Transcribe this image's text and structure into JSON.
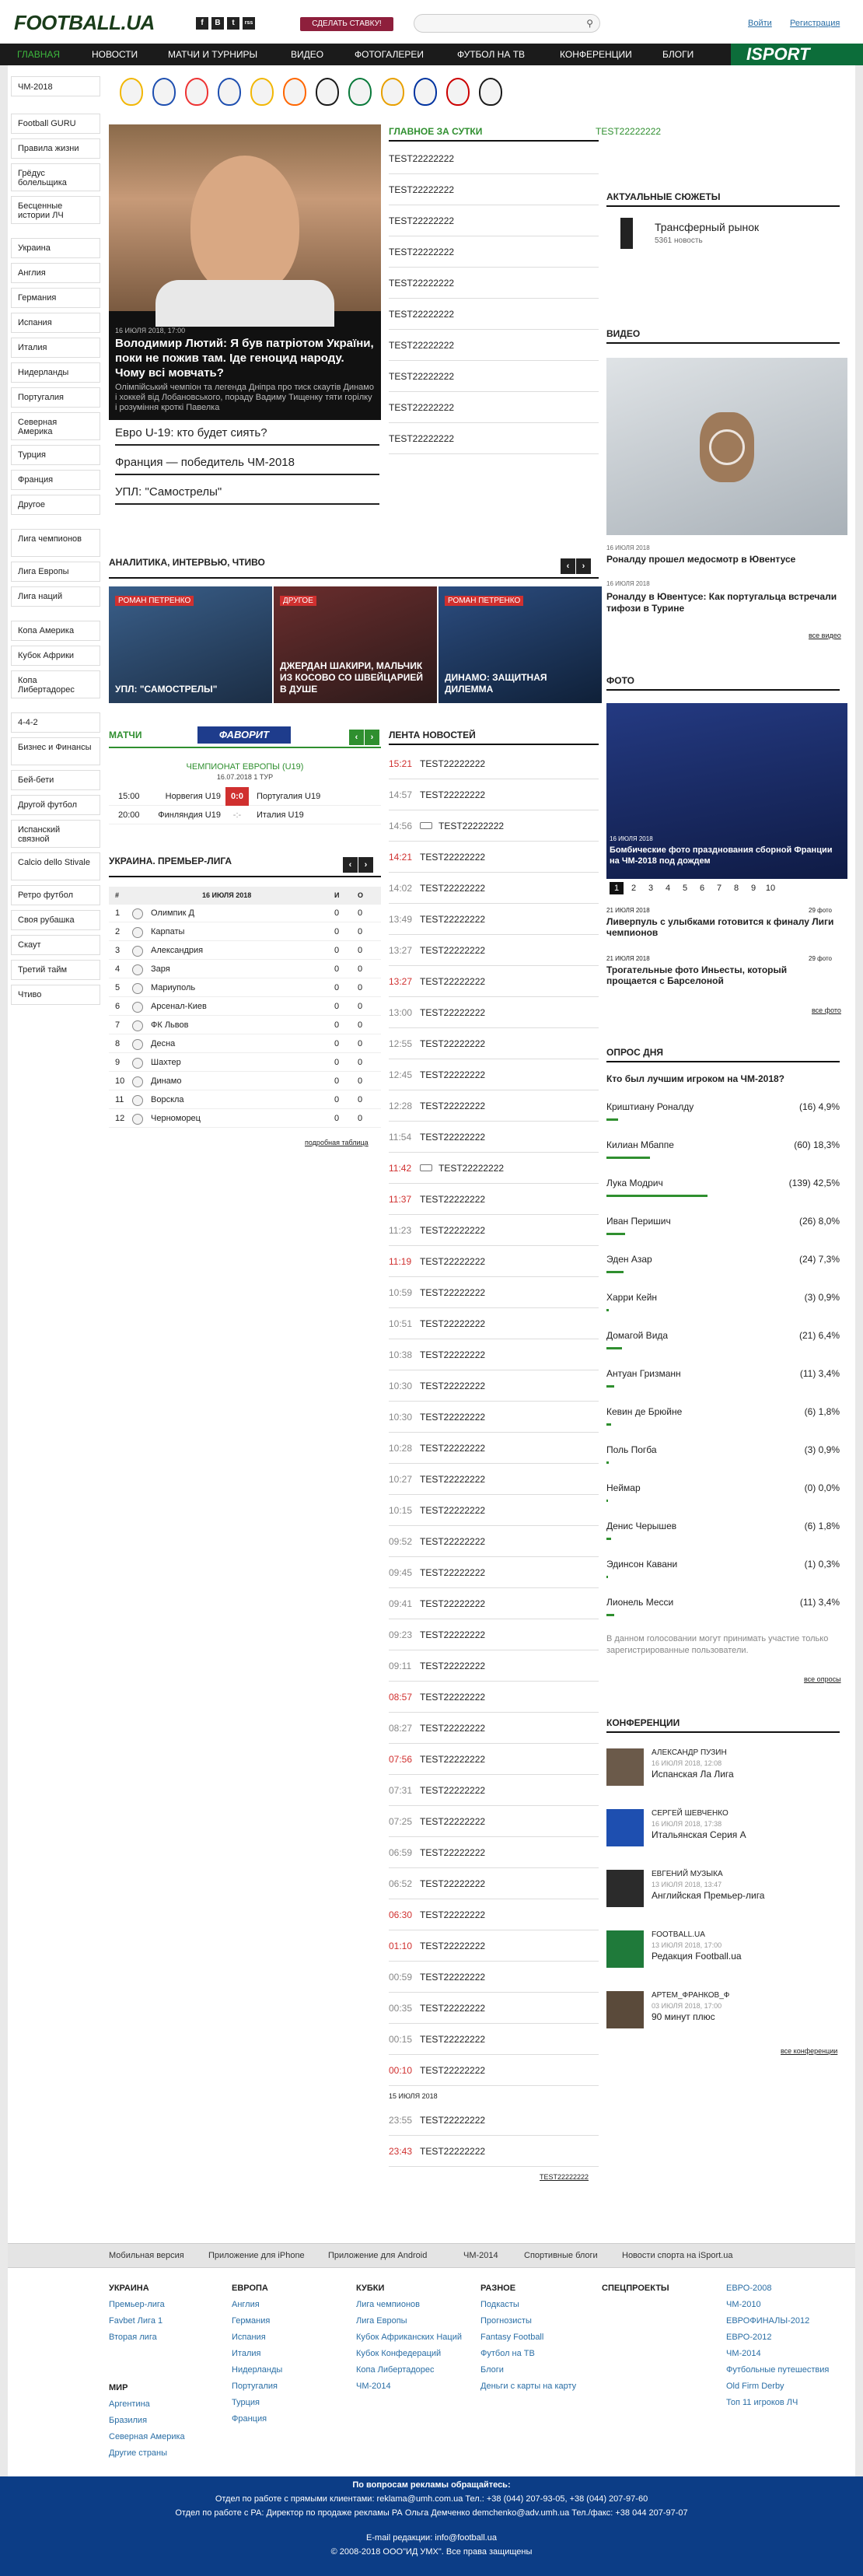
{
  "header": {
    "logo": "FOOTBALL.UA",
    "social": [
      "f",
      "В",
      "t",
      "rss"
    ],
    "start_button": "СДЕЛАТЬ СТАВКУ!",
    "login": "Войти",
    "register": "Регистрация",
    "isport": "ISPORT"
  },
  "nav": {
    "items": [
      "ГЛАВНАЯ",
      "НОВОСТИ",
      "МАТЧИ И ТУРНИРЫ",
      "ВИДЕО",
      "ФОТОГАЛЕРЕИ",
      "ФУТБОЛ НА ТВ",
      "КОНФЕРЕНЦИИ",
      "БЛОГИ"
    ]
  },
  "sidebar": {
    "top": "ЧМ-2018",
    "groups": [
      [
        "Football GURU",
        "Правила жизни",
        "Грёдус болельщика",
        "Бесценные истории ЛЧ"
      ],
      [
        "Украина",
        "Англия",
        "Германия",
        "Испания",
        "Италия",
        "Нидерланды",
        "Португалия",
        "Северная Америка",
        "Турция",
        "Франция",
        "Другое"
      ],
      [
        "Лига чемпионов",
        "Лига Европы",
        "Лига наций"
      ],
      [
        "Копа Америка",
        "Кубок Африки",
        "Копа Либертадорес"
      ],
      [
        "4-4-2",
        "Бизнес и Финансы",
        "Бей-бети",
        "Другой футбол",
        "Испанский связной",
        "Calcio dello Stivale",
        "Ретро футбол",
        "Своя рубашка",
        "Скаут",
        "Третий тайм",
        "Чтиво"
      ]
    ]
  },
  "hero": {
    "date": "16 ИЮЛЯ 2018, 17:00",
    "title": "Володимир Лютий: Я був патріотом України, поки не пожив там. Іде геноцид народу. Чому всі мовчать?",
    "sub": "Олімпійський чемпіон та легенда Дніпра про тиск скаутів Динамо і хоккей від Лобановського, пораду Вадиму Тищенку тяти горілку і розуміння кроткі Павелка"
  },
  "top_links": [
    "Евро U-19: кто будет сиять?",
    "Франция — победитель ЧМ-2018",
    "УПЛ: \"Самострелы\""
  ],
  "main_day": {
    "title": "ГЛАВНОЕ ЗА СУТКИ",
    "side_label": "TEST22222222",
    "items": [
      "TEST22222222",
      "TEST22222222",
      "TEST22222222",
      "TEST22222222",
      "TEST22222222",
      "TEST22222222",
      "TEST22222222",
      "TEST22222222",
      "TEST22222222",
      "TEST22222222"
    ]
  },
  "analytics": {
    "title": "АНАЛИТИКА, ИНТЕРВЬЮ, ЧТИВО",
    "cards": [
      {
        "tag": "РОМАН ПЕТРЕНКО",
        "title": "УПЛ: \"САМОСТРЕЛЫ\""
      },
      {
        "tag": "ДРУГОЕ",
        "title": "ДЖЕРДАН ШАКИРИ, МАЛЬЧИК ИЗ КОСОВО СО ШВЕЙЦАРИЕЙ В ДУШЕ"
      },
      {
        "tag": "РОМАН ПЕТРЕНКО",
        "title": "ДИНАМО: ЗАЩИТНАЯ ДИЛЕММА"
      }
    ]
  },
  "matches": {
    "title": "МАТЧИ",
    "sponsor": "ФАВОРИТ",
    "league": "ЧЕМПИОНАТ ЕВРОПЫ (U19)",
    "round": "16.07.2018 1 ТУР",
    "games": [
      {
        "time": "15:00",
        "home": "Норвегия U19",
        "score": "0:0",
        "away": "Португалия U19"
      },
      {
        "time": "20:00",
        "home": "Финляндия U19",
        "score": "-:-",
        "away": "Италия U19"
      }
    ]
  },
  "league_table": {
    "title": "УКРАИНА. ПРЕМЬЕР-ЛИГА",
    "col_num": "#",
    "col_date": "16 ИЮЛЯ 2018",
    "col_games": "И",
    "col_points": "О",
    "rows": [
      [
        "1",
        "Олимпик Д",
        "0",
        "0"
      ],
      [
        "2",
        "Карпаты",
        "0",
        "0"
      ],
      [
        "3",
        "Александрия",
        "0",
        "0"
      ],
      [
        "4",
        "Заря",
        "0",
        "0"
      ],
      [
        "5",
        "Мариуполь",
        "0",
        "0"
      ],
      [
        "6",
        "Арсенал-Киев",
        "0",
        "0"
      ],
      [
        "7",
        "ФК Львов",
        "0",
        "0"
      ],
      [
        "8",
        "Десна",
        "0",
        "0"
      ],
      [
        "9",
        "Шахтер",
        "0",
        "0"
      ],
      [
        "10",
        "Динамо",
        "0",
        "0"
      ],
      [
        "11",
        "Ворскла",
        "0",
        "0"
      ],
      [
        "12",
        "Черноморец",
        "0",
        "0"
      ]
    ],
    "more": "подробная таблица"
  },
  "news_feed": {
    "title": "ЛЕНТА НОВОСТЕЙ",
    "items": [
      [
        "15:21",
        "TEST22222222",
        "red"
      ],
      [
        "14:57",
        "TEST22222222",
        ""
      ],
      [
        "14:56",
        "TEST22222222",
        "cam"
      ],
      [
        "14:21",
        "TEST22222222",
        "red"
      ],
      [
        "14:02",
        "TEST22222222",
        ""
      ],
      [
        "13:49",
        "TEST22222222",
        ""
      ],
      [
        "13:27",
        "TEST22222222",
        ""
      ],
      [
        "13:27",
        "TEST22222222",
        "red"
      ],
      [
        "13:00",
        "TEST22222222",
        ""
      ],
      [
        "12:55",
        "TEST22222222",
        ""
      ],
      [
        "12:45",
        "TEST22222222",
        ""
      ],
      [
        "12:28",
        "TEST22222222",
        ""
      ],
      [
        "11:54",
        "TEST22222222",
        ""
      ],
      [
        "11:42",
        "TEST22222222",
        "redcam"
      ],
      [
        "11:37",
        "TEST22222222",
        "red"
      ],
      [
        "11:23",
        "TEST22222222",
        ""
      ],
      [
        "11:19",
        "TEST22222222",
        "red"
      ],
      [
        "10:59",
        "TEST22222222",
        ""
      ],
      [
        "10:51",
        "TEST22222222",
        ""
      ],
      [
        "10:38",
        "TEST22222222",
        ""
      ],
      [
        "10:30",
        "TEST22222222",
        ""
      ],
      [
        "10:30",
        "TEST22222222",
        ""
      ],
      [
        "10:28",
        "TEST22222222",
        ""
      ],
      [
        "10:27",
        "TEST22222222",
        ""
      ],
      [
        "10:15",
        "TEST22222222",
        ""
      ],
      [
        "09:52",
        "TEST22222222",
        ""
      ],
      [
        "09:45",
        "TEST22222222",
        ""
      ],
      [
        "09:41",
        "TEST22222222",
        ""
      ],
      [
        "09:23",
        "TEST22222222",
        ""
      ],
      [
        "09:11",
        "TEST22222222",
        ""
      ],
      [
        "08:57",
        "TEST22222222",
        "red"
      ],
      [
        "08:27",
        "TEST22222222",
        ""
      ],
      [
        "07:56",
        "TEST22222222",
        "red"
      ],
      [
        "07:31",
        "TEST22222222",
        ""
      ],
      [
        "07:25",
        "TEST22222222",
        ""
      ],
      [
        "06:59",
        "TEST22222222",
        ""
      ],
      [
        "06:52",
        "TEST22222222",
        ""
      ],
      [
        "06:30",
        "TEST22222222",
        "red"
      ],
      [
        "01:10",
        "TEST22222222",
        "red"
      ],
      [
        "00:59",
        "TEST22222222",
        ""
      ],
      [
        "00:35",
        "TEST22222222",
        ""
      ],
      [
        "00:15",
        "TEST22222222",
        ""
      ],
      [
        "00:10",
        "TEST22222222",
        "red"
      ]
    ],
    "date_sep": "15 ИЮЛЯ 2018",
    "after": [
      [
        "23:55",
        "TEST22222222",
        ""
      ],
      [
        "23:43",
        "TEST22222222",
        "red"
      ]
    ],
    "more": "TEST22222222"
  },
  "stories": {
    "title": "АКТУАЛЬНЫЕ СЮЖЕТЫ",
    "name": "Трансферный рынок",
    "count": "5361 новость"
  },
  "video": {
    "title": "ВИДЕО",
    "items": [
      {
        "date": "16 ИЮЛЯ 2018",
        "title": "Роналду прошел медосмотр в Ювентусе"
      },
      {
        "date": "16 ИЮЛЯ 2018",
        "title": "Роналду в Ювентусе: Как португальца встречали тифози в Турине"
      }
    ],
    "more": "все видео"
  },
  "photo": {
    "title": "ФОТО",
    "date": "16 ИЮЛЯ 2018",
    "caption": "Бомбические фото празднования сборной Франции на ЧМ-2018 под дождем",
    "pages": [
      "1",
      "2",
      "3",
      "4",
      "5",
      "6",
      "7",
      "8",
      "9",
      "10"
    ],
    "items": [
      {
        "date": "21 ИЮЛЯ 2018",
        "count": "29 фото",
        "title": "Ливерпуль с улыбками готовится к финалу Лиги чемпионов"
      },
      {
        "date": "21 ИЮЛЯ 2018",
        "count": "29 фото",
        "title": "Трогательные фото Иньесты, который прощается с Барселоной"
      }
    ],
    "more": "все фото"
  },
  "poll": {
    "title": "ОПРОС ДНЯ",
    "question": "Кто был лучшим игроком на ЧМ-2018?",
    "options": [
      [
        "Криштиану Роналду",
        "(16) 4,9%",
        4.9
      ],
      [
        "Килиан Мбаппе",
        "(60) 18,3%",
        18.3
      ],
      [
        "Лука Модрич",
        "(139) 42,5%",
        42.5
      ],
      [
        "Иван Перишич",
        "(26) 8,0%",
        8.0
      ],
      [
        "Эден Азар",
        "(24) 7,3%",
        7.3
      ],
      [
        "Харри Кейн",
        "(3) 0,9%",
        0.9
      ],
      [
        "Домагой Вида",
        "(21) 6,4%",
        6.4
      ],
      [
        "Антуан Гризманн",
        "(11) 3,4%",
        3.4
      ],
      [
        "Кевин де Брюйне",
        "(6) 1,8%",
        1.8
      ],
      [
        "Поль Погба",
        "(3) 0,9%",
        0.9
      ],
      [
        "Неймар",
        "(0) 0,0%",
        0
      ],
      [
        "Денис Черышев",
        "(6) 1,8%",
        1.8
      ],
      [
        "Эдинсон Кавани",
        "(1) 0,3%",
        0.3
      ],
      [
        "Лионель Месси",
        "(11) 3,4%",
        3.4
      ]
    ],
    "note": "В данном голосовании могут принимать участие только зарегистрированные пользователи.",
    "more": "все опросы"
  },
  "conferences": {
    "title": "КОНФЕРЕНЦИИ",
    "items": [
      {
        "name": "АЛЕКСАНДР ПУЗИН",
        "date": "16 ИЮЛЯ 2018, 12:08",
        "subject": "Испанская Ла Лига"
      },
      {
        "name": "СЕРГЕЙ ШЕВЧЕНКО",
        "date": "16 ИЮЛЯ 2018, 17:38",
        "subject": "Итальянская Серия А"
      },
      {
        "name": "ЕВГЕНИЙ МУЗЫКА",
        "date": "13 ИЮЛЯ 2018, 13:47",
        "subject": "Английская Премьер-лига"
      },
      {
        "name": "FOOTBALL.UA",
        "date": "13 ИЮЛЯ 2018, 17:00",
        "subject": "Редакция Football.ua"
      },
      {
        "name": "АРТЕМ_ФРАНКОВ_Ф",
        "date": "03 ИЮЛЯ 2018, 17:00",
        "subject": "90 минут плюс"
      }
    ],
    "more": "все конференции"
  },
  "footer": {
    "links": [
      "Мобильная версия",
      "Приложение для iPhone",
      "Приложение для Android",
      "ЧМ-2014",
      "Спортивные блоги",
      "Новости спорта на iSport.ua"
    ],
    "cols": [
      {
        "title": "УКРАИНА",
        "items": [
          "Премьер-лига",
          "Favbet Лига 1",
          "Вторая лига"
        ]
      },
      {
        "title": "ЕВРОПА",
        "items": [
          "Англия",
          "Германия",
          "Испания",
          "Италия",
          "Нидерланды",
          "Португалия",
          "Турция",
          "Франция"
        ]
      },
      {
        "title": "КУБКИ",
        "items": [
          "Лига чемпионов",
          "Лига Европы",
          "Кубок Африканских Наций",
          "Кубок Конфедераций",
          "Копа Либертадорес",
          "ЧМ-2014"
        ]
      },
      {
        "title": "РАЗНОЕ",
        "items": [
          "Подкасты",
          "Прогнозисты",
          "Fantasy Football",
          "Футбол на ТВ",
          "Блоги",
          "Деньги с карты на карту"
        ]
      },
      {
        "title": "СПЕЦПРОЕКТЫ",
        "items": []
      },
      {
        "title": "",
        "items": [
          "ЕВРО-2008",
          "ЧМ-2010",
          "ЕВРОФИНАЛЫ-2012",
          "ЕВРО-2012",
          "ЧМ-2014",
          "Футбольные путешествия",
          "Old Firm Derby",
          "Топ 11 игроков ЛЧ"
        ]
      },
      {
        "title": "МИР",
        "items": [
          "Аргентина",
          "Бразилия",
          "Северная Америка",
          "Другие страны"
        ]
      }
    ],
    "bottom": [
      "По вопросам рекламы обращайтесь:",
      "Отдел по работе с прямыми клиентами: reklama@umh.com.ua Тел.: +38 (044) 207-93-05, +38 (044) 207-97-60",
      "Отдел по работе с РА: Директор по продаже рекламы РА Ольга Демченко demchenko@adv.umh.ua Тел./факс: +38 044 207-97-07",
      "E-mail редакции: info@football.ua",
      "© 2008-2018 ООО\"ИД УМХ\". Все права защищены"
    ]
  }
}
